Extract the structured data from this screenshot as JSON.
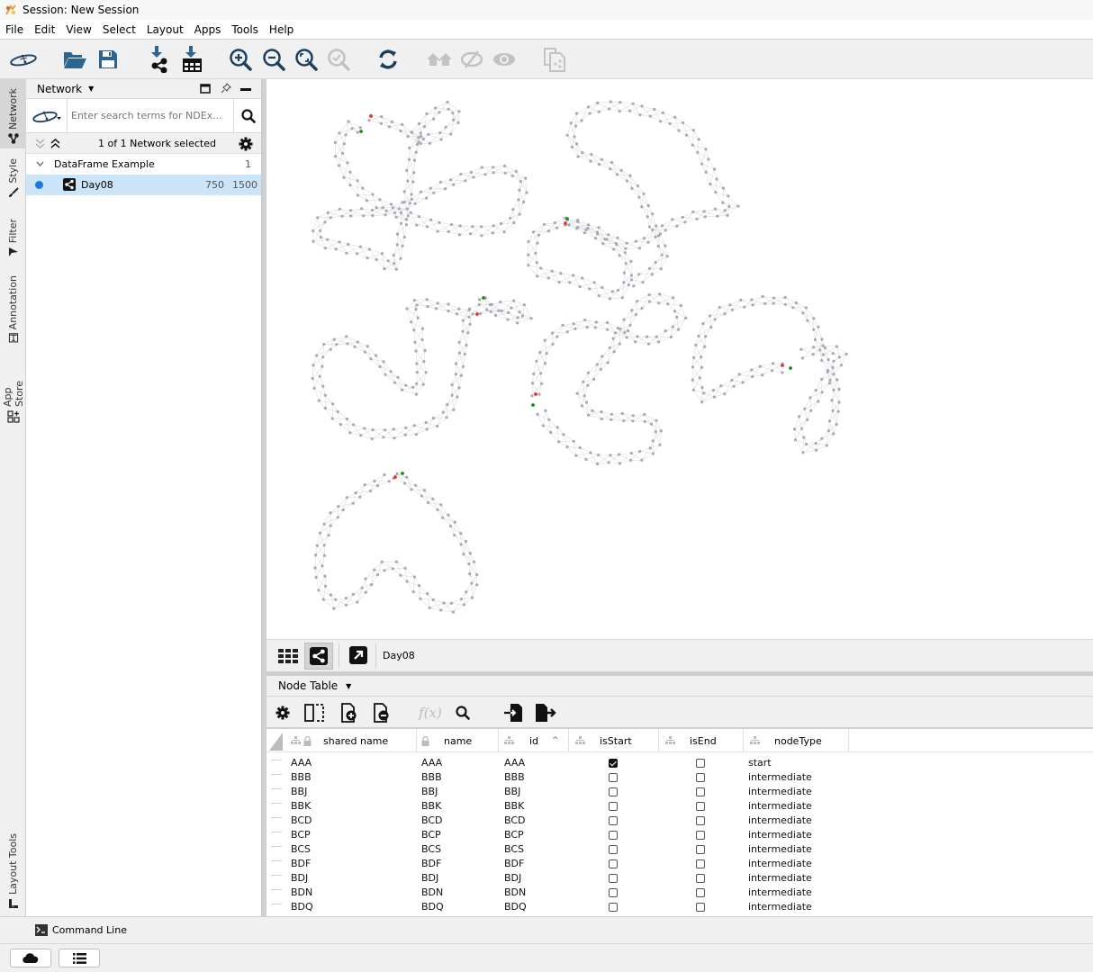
{
  "window": {
    "title": "Session: New Session"
  },
  "menu": [
    "File",
    "Edit",
    "View",
    "Select",
    "Layout",
    "Apps",
    "Tools",
    "Help"
  ],
  "toolbar": {
    "icons": [
      "ndex-icon",
      "open-folder-icon",
      "save-icon",
      "import-network-icon",
      "import-table-icon",
      "zoom-in-icon",
      "zoom-out-icon",
      "zoom-fit-icon",
      "zoom-selected-icon",
      "refresh-icon",
      "home-icon",
      "hide-icon",
      "show-icon",
      "new-network-icon"
    ]
  },
  "side_tabs": [
    "Network",
    "Style",
    "Filter",
    "Annotation",
    "App Store",
    "Layout Tools"
  ],
  "network_panel": {
    "dropdown_label": "Network",
    "search_placeholder": "Enter search terms for NDEx...",
    "selection_text": "1 of 1 Network selected",
    "collection": {
      "name": "DataFrame Example",
      "count": "1"
    },
    "networks": [
      {
        "name": "Day08",
        "nodes": "750",
        "edges": "1500",
        "selected": true
      }
    ]
  },
  "view_bar": {
    "network_title": "Day08"
  },
  "table_panel": {
    "dropdown_label": "Node Table",
    "columns": [
      "shared name",
      "name",
      "id",
      "isStart",
      "isEnd",
      "nodeType"
    ],
    "sorted_column": "id",
    "rows": [
      {
        "shared_name": "AAA",
        "name": "AAA",
        "id": "AAA",
        "isStart": true,
        "isEnd": false,
        "nodeType": "start"
      },
      {
        "shared_name": "BBB",
        "name": "BBB",
        "id": "BBB",
        "isStart": false,
        "isEnd": false,
        "nodeType": "intermediate"
      },
      {
        "shared_name": "BBJ",
        "name": "BBJ",
        "id": "BBJ",
        "isStart": false,
        "isEnd": false,
        "nodeType": "intermediate"
      },
      {
        "shared_name": "BBK",
        "name": "BBK",
        "id": "BBK",
        "isStart": false,
        "isEnd": false,
        "nodeType": "intermediate"
      },
      {
        "shared_name": "BCD",
        "name": "BCD",
        "id": "BCD",
        "isStart": false,
        "isEnd": false,
        "nodeType": "intermediate"
      },
      {
        "shared_name": "BCP",
        "name": "BCP",
        "id": "BCP",
        "isStart": false,
        "isEnd": false,
        "nodeType": "intermediate"
      },
      {
        "shared_name": "BCS",
        "name": "BCS",
        "id": "BCS",
        "isStart": false,
        "isEnd": false,
        "nodeType": "intermediate"
      },
      {
        "shared_name": "BDF",
        "name": "BDF",
        "id": "BDF",
        "isStart": false,
        "isEnd": false,
        "nodeType": "intermediate"
      },
      {
        "shared_name": "BDJ",
        "name": "BDJ",
        "id": "BDJ",
        "isStart": false,
        "isEnd": false,
        "nodeType": "intermediate"
      },
      {
        "shared_name": "BDN",
        "name": "BDN",
        "id": "BDN",
        "isStart": false,
        "isEnd": false,
        "nodeType": "intermediate"
      },
      {
        "shared_name": "BDQ",
        "name": "BDQ",
        "id": "BDQ",
        "isStart": false,
        "isEnd": false,
        "nodeType": "intermediate"
      }
    ]
  },
  "command_line": {
    "label": "Command Line"
  },
  "colors": {
    "accent": "#2a6496",
    "node": "#a8a8b4",
    "edge": "#dcdcdc",
    "start_node": "#1a8a1a",
    "end_node": "#e83030",
    "selected_row": "#cce4f7",
    "selection_dot": "#1a7ae0"
  }
}
